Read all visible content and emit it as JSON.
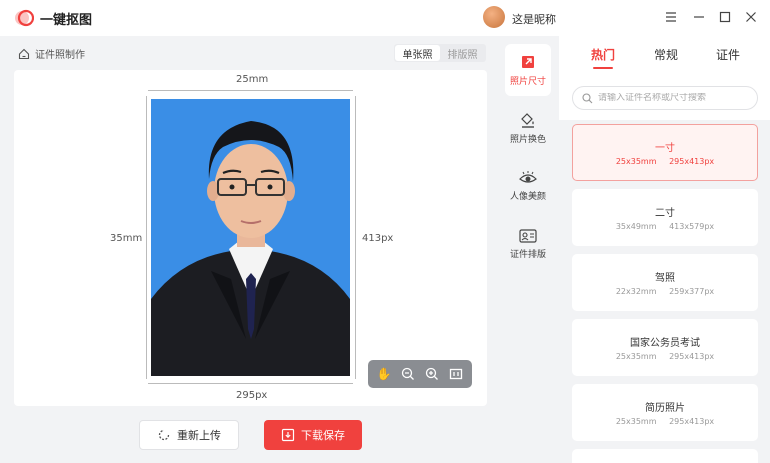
{
  "app": {
    "title": "一键抠图",
    "nickname": "这是昵称"
  },
  "breadcrumb": {
    "label": "证件照制作"
  },
  "view_toggle": {
    "single": "单张照",
    "layout": "排版照"
  },
  "photo": {
    "top_width_label": "25mm",
    "bottom_width_label": "295px",
    "left_height_label": "35mm",
    "right_height_label": "413px",
    "background_color": "#3a8ee6"
  },
  "actions": {
    "reupload": "重新上传",
    "save": "下载保存"
  },
  "tools": [
    {
      "label": "照片尺寸",
      "icon": "crop-icon"
    },
    {
      "label": "照片换色",
      "icon": "paint-bucket-icon"
    },
    {
      "label": "人像美颜",
      "icon": "eye-icon"
    },
    {
      "label": "证件排版",
      "icon": "id-card-icon"
    }
  ],
  "tabs": {
    "hot": "热门",
    "common": "常规",
    "id": "证件"
  },
  "search": {
    "placeholder": "请输入证件名称或尺寸搜索"
  },
  "sizes": [
    {
      "name": "一寸",
      "mm": "25x35mm",
      "px": "295x413px"
    },
    {
      "name": "二寸",
      "mm": "35x49mm",
      "px": "413x579px"
    },
    {
      "name": "驾照",
      "mm": "22x32mm",
      "px": "259x377px"
    },
    {
      "name": "国家公务员考试",
      "mm": "25x35mm",
      "px": "295x413px"
    },
    {
      "name": "简历照片",
      "mm": "25x35mm",
      "px": "295x413px"
    }
  ],
  "colors": {
    "accent": "#f0413e",
    "background": "#f2f3f5"
  }
}
